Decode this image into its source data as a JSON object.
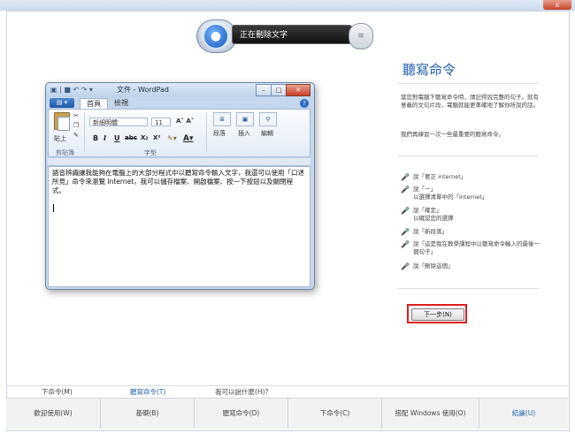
{
  "window": {
    "close_label": "x"
  },
  "speech_bar": {
    "status": "正在刪除文字"
  },
  "wordpad": {
    "title": "文件 - WordPad",
    "tabs": [
      "首頁",
      "檢視"
    ],
    "font_name": "新細明體",
    "font_size": "11",
    "groups": {
      "clipboard": "剪貼簿",
      "font": "字型"
    },
    "paste_label": "貼上",
    "paragraph_label": "段落",
    "insert_label": "插入",
    "edit_label": "編輯",
    "document_text": "語音辨識讓我能夠在電腦上的大部分程式中以聽寫命令輸入文字，我還可以使用「口述所見」命令來瀏覽 Internet，我可以儲存檔案、開啟檔案、按一下按鈕以及關閉程式。"
  },
  "panel": {
    "title": "聽寫命令",
    "description": "當您對電腦下聽寫命令時，請記得說完整的句子。就有意義的文句片段，電腦就能更準確地了解你所說的話。",
    "description2": "我們再練習一次一些最重要的聽寫命令。",
    "commands": [
      {
        "text": "說「要正 internet」"
      },
      {
        "text": "說「一」\n以選擇清單中的「Internet」"
      },
      {
        "text": "說「確定」\n以確認您的選擇"
      },
      {
        "text": "說「新段落」"
      },
      {
        "text": "說「這是我在教學課程中以聽寫命令輸入的最後一個句子」"
      },
      {
        "text": "說「刪除這個」"
      }
    ],
    "next_button": "下一步(N)"
  },
  "bottom_links": [
    {
      "label": "下命令(M)"
    },
    {
      "label": "聽寫命令(T)",
      "active": true
    },
    {
      "label": "我可以說什麼(H)？"
    }
  ],
  "bottom_nav": [
    {
      "label": "歡迎使用(W)"
    },
    {
      "label": "基礎(B)"
    },
    {
      "label": "聽寫命令(D)"
    },
    {
      "label": "下命令(C)"
    },
    {
      "label": "搭配 Windows 使用(O)"
    },
    {
      "label": "結論(U)",
      "active": true
    }
  ],
  "colors": {
    "accent": "#1e5ea8",
    "highlight": "#e01d1d"
  }
}
